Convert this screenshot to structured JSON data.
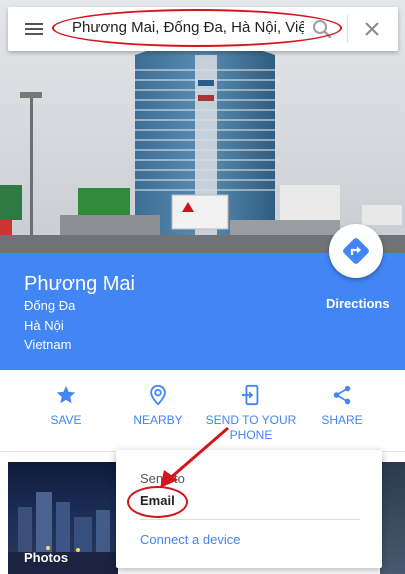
{
  "search": {
    "query": "Phương Mai, Đống Đa, Hà Nội, Việt Nam"
  },
  "place": {
    "title": "Phương Mai",
    "address_lines": [
      "Đống Đa",
      "Hà Nội",
      "Vietnam"
    ],
    "directions_label": "Directions"
  },
  "actions": {
    "save": "SAVE",
    "nearby": "NEARBY",
    "send_line1": "SEND TO YOUR",
    "send_line2": "PHONE",
    "share": "SHARE"
  },
  "photos": {
    "label": "Photos"
  },
  "popup": {
    "header": "Send to",
    "email": "Email",
    "connect": "Connect a device"
  },
  "colors": {
    "accent": "#4285f4",
    "annotation": "#d4141b"
  }
}
